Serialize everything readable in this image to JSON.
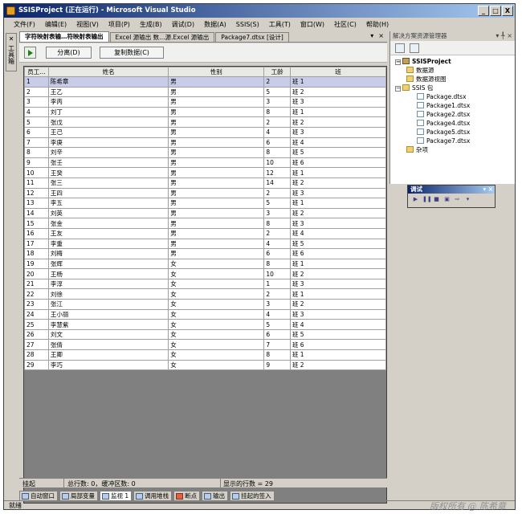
{
  "window": {
    "title": "SSISProject (正在运行) - Microsoft Visual Studio",
    "min_label": "_",
    "max_label": "□",
    "close_label": "X"
  },
  "menu": [
    "文件(F)",
    "编辑(E)",
    "视图(V)",
    "项目(P)",
    "生成(B)",
    "调试(D)",
    "数据(A)",
    "SSIS(S)",
    "工具(T)",
    "窗口(W)",
    "社区(C)",
    "帮助(H)"
  ],
  "toolbox": {
    "label": "工具箱"
  },
  "tabs": {
    "active": "字符映射表输…符映射表输出",
    "items": [
      "Excel 源输出 数…源.Excel 源输出",
      "Package7.dtsx [设计]"
    ],
    "close": "×"
  },
  "viewer": {
    "detach_label": "分离(D)",
    "copy_label": "复制数据(C)"
  },
  "grid": {
    "columns": [
      "员工…",
      "姓名",
      "性别",
      "工龄",
      "班"
    ],
    "rows": [
      [
        "1",
        "陈希章",
        "男",
        "2",
        "班 1"
      ],
      [
        "2",
        "王乙",
        "男",
        "5",
        "班 2"
      ],
      [
        "3",
        "李丙",
        "男",
        "3",
        "班 3"
      ],
      [
        "4",
        "刘丁",
        "男",
        "8",
        "班 1"
      ],
      [
        "5",
        "张戊",
        "男",
        "2",
        "班 2"
      ],
      [
        "6",
        "王己",
        "男",
        "4",
        "班 3"
      ],
      [
        "7",
        "李庚",
        "男",
        "6",
        "班 4"
      ],
      [
        "8",
        "刘辛",
        "男",
        "8",
        "班 5"
      ],
      [
        "9",
        "张壬",
        "男",
        "10",
        "班 6"
      ],
      [
        "10",
        "王癸",
        "男",
        "12",
        "班 1"
      ],
      [
        "11",
        "张三",
        "男",
        "14",
        "班 2"
      ],
      [
        "12",
        "王四",
        "男",
        "2",
        "班 3"
      ],
      [
        "13",
        "李五",
        "男",
        "5",
        "班 1"
      ],
      [
        "14",
        "刘英",
        "男",
        "3",
        "班 2"
      ],
      [
        "15",
        "张金",
        "男",
        "8",
        "班 3"
      ],
      [
        "16",
        "王友",
        "男",
        "2",
        "班 4"
      ],
      [
        "17",
        "李重",
        "男",
        "4",
        "班 5"
      ],
      [
        "18",
        "刘梅",
        "男",
        "6",
        "班 6"
      ],
      [
        "19",
        "张辉",
        "女",
        "8",
        "班 1"
      ],
      [
        "20",
        "王杨",
        "女",
        "10",
        "班 2"
      ],
      [
        "21",
        "李淳",
        "女",
        "1",
        "班 3"
      ],
      [
        "22",
        "刘徐",
        "女",
        "2",
        "班 1"
      ],
      [
        "23",
        "张江",
        "女",
        "3",
        "班 2"
      ],
      [
        "24",
        "王小丽",
        "女",
        "4",
        "班 3"
      ],
      [
        "25",
        "李慧紫",
        "女",
        "5",
        "班 4"
      ],
      [
        "26",
        "刘文",
        "女",
        "6",
        "班 5"
      ],
      [
        "27",
        "张倩",
        "女",
        "7",
        "班 6"
      ],
      [
        "28",
        "王卿",
        "女",
        "8",
        "班 1"
      ],
      [
        "29",
        "李巧",
        "女",
        "9",
        "班 2"
      ]
    ]
  },
  "grid_status": {
    "state": "挂起",
    "totals": "总行数: 0，缓冲区数: 0",
    "shown": "显示的行数 = 29"
  },
  "bottom_tabs": [
    "自动窗口",
    "局部变量",
    "监视 1",
    "调用堆栈",
    "断点",
    "输出",
    "挂起的签入"
  ],
  "statusbar": "就绪",
  "solution": {
    "title": "解决方案资源管理器",
    "controls": "▾ ╀ ×",
    "project": "SSISProject",
    "data_sources": "数据源",
    "data_source_views": "数据源视图",
    "packages_folder": "SSIS 包",
    "packages": [
      "Package.dtsx",
      "Package1.dtsx",
      "Package2.dtsx",
      "Package4.dtsx",
      "Package5.dtsx",
      "Package7.dtsx"
    ],
    "misc": "杂项"
  },
  "debug": {
    "title": "调试",
    "controls": "▾ ×"
  },
  "watermark": "版权所有 @ 陈希章"
}
